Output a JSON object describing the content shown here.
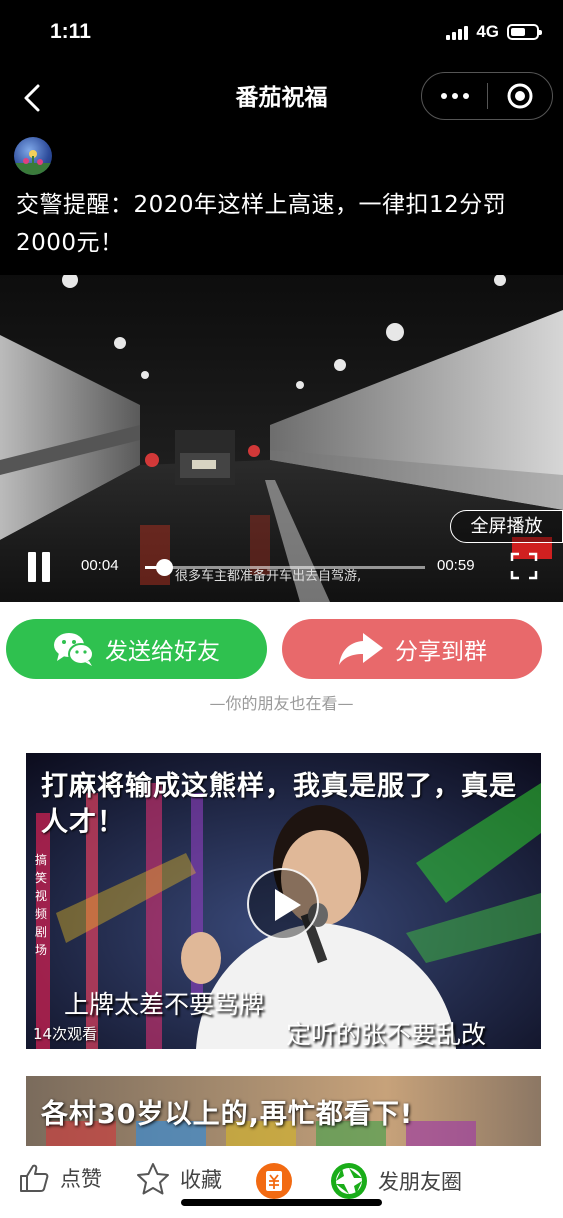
{
  "status_bar": {
    "time": "1:11",
    "network": "4G"
  },
  "nav": {
    "title": "番茄祝福"
  },
  "article": {
    "title": "交警提醒：2020年这样上高速，一律扣12分罚2000元！"
  },
  "video": {
    "fullscreen_label": "全屏播放",
    "current_time": "00:04",
    "duration": "00:59",
    "progress_fraction": 0.068,
    "subtitle": "很多车主都准备开车出去自驾游,"
  },
  "actions": {
    "send_friend_label": "发送给好友",
    "share_group_label": "分享到群",
    "friends_watching": "—你的朋友也在看—"
  },
  "recommendations": [
    {
      "title": "打麻将输成这熊样，我真是服了，真是人才！",
      "views": "14次观看",
      "subtitle_1": "上牌太差不要骂牌",
      "subtitle_2": "定听的张不要乱改",
      "side_text": "搞笑视频剧场"
    },
    {
      "title": "各村30岁以上的,再忙都看下!"
    }
  ],
  "bottom_bar": {
    "like_label": "点赞",
    "favorite_label": "收藏",
    "moments_label": "发朋友圈"
  },
  "colors": {
    "send_green": "#2fc14f",
    "share_red": "#e8696b",
    "moments_green": "#1aad19",
    "coin_orange": "#f26a12"
  }
}
